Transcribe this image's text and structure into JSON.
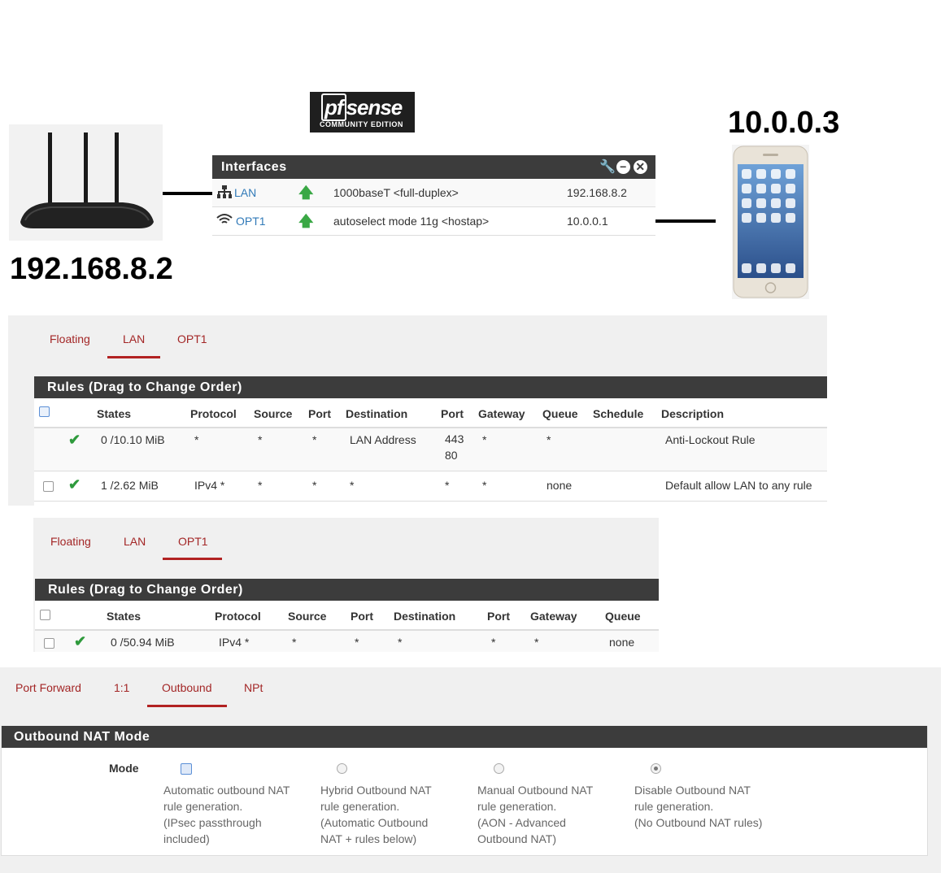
{
  "diagram": {
    "router_ip": "192.168.8.2",
    "phone_ip": "10.0.0.3"
  },
  "logo": {
    "brand_pf": "pf",
    "brand_sense": "sense",
    "edition": "COMMUNITY EDITION"
  },
  "interfaces_widget": {
    "title": "Interfaces",
    "rows": [
      {
        "icon": "network-icon",
        "name": "LAN",
        "media": "1000baseT <full-duplex>",
        "ip": "192.168.8.2"
      },
      {
        "icon": "wifi-icon",
        "name": "OPT1",
        "media": "autoselect mode 11g <hostap>",
        "ip": "10.0.0.1"
      }
    ]
  },
  "lan_rules": {
    "tabs": [
      "Floating",
      "LAN",
      "OPT1"
    ],
    "active_tab": "LAN",
    "panel_title": "Rules (Drag to Change Order)",
    "headers": [
      "States",
      "Protocol",
      "Source",
      "Port",
      "Destination",
      "Port",
      "Gateway",
      "Queue",
      "Schedule",
      "Description"
    ],
    "rows": [
      {
        "states": "0 /10.10 MiB",
        "protocol": "*",
        "source": "*",
        "port": "*",
        "destination": "LAN Address",
        "dport": "443\n80",
        "gateway": "*",
        "queue": "*",
        "schedule": "",
        "description": "Anti-Lockout Rule"
      },
      {
        "states": "1 /2.62 MiB",
        "protocol": "IPv4 *",
        "source": "*",
        "port": "*",
        "destination": "*",
        "dport": "*",
        "gateway": "*",
        "queue": "none",
        "schedule": "",
        "description": "Default allow LAN to any rule"
      }
    ]
  },
  "opt1_rules": {
    "tabs": [
      "Floating",
      "LAN",
      "OPT1"
    ],
    "active_tab": "OPT1",
    "panel_title": "Rules (Drag to Change Order)",
    "headers": [
      "States",
      "Protocol",
      "Source",
      "Port",
      "Destination",
      "Port",
      "Gateway",
      "Queue"
    ],
    "rows": [
      {
        "states": "0 /50.94 MiB",
        "protocol": "IPv4 *",
        "source": "*",
        "port": "*",
        "destination": "*",
        "dport": "*",
        "gateway": "*",
        "queue": "none"
      }
    ]
  },
  "nat": {
    "tabs": [
      "Port Forward",
      "1:1",
      "Outbound",
      "NPt"
    ],
    "active_tab": "Outbound",
    "panel_title": "Outbound NAT Mode",
    "mode_label": "Mode",
    "options": [
      {
        "text": "Automatic outbound NAT\nrule generation.\n(IPsec passthrough\nincluded)",
        "selected": false
      },
      {
        "text": "Hybrid Outbound NAT\nrule generation.\n(Automatic Outbound\nNAT + rules below)",
        "selected": false
      },
      {
        "text": "Manual Outbound NAT\nrule generation.\n(AON - Advanced\nOutbound NAT)",
        "selected": false
      },
      {
        "text": "Disable Outbound NAT\nrule generation.\n(No Outbound NAT rules)",
        "selected": true
      }
    ]
  },
  "colors": {
    "panel_header": "#3c3c3c",
    "tab_active": "#b22222",
    "link": "#317ab8",
    "status_up": "#3aa845"
  }
}
